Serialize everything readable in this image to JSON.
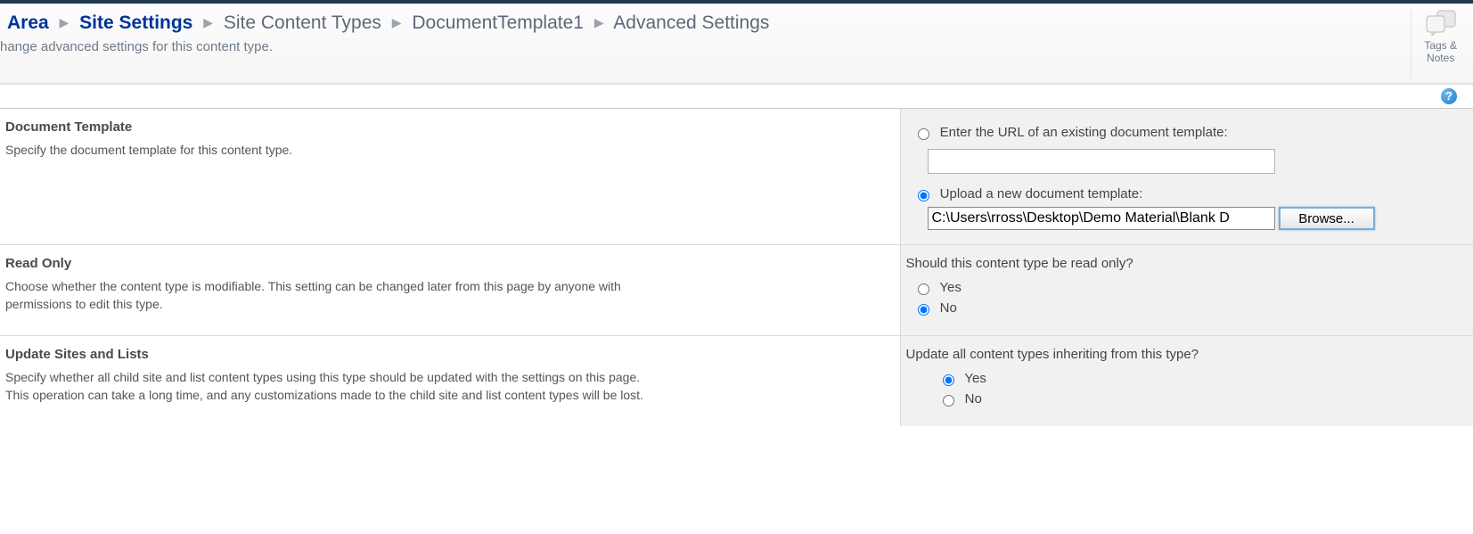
{
  "header": {
    "breadcrumb": {
      "area": "Area",
      "site_settings": "Site Settings",
      "site_content_types": "Site Content Types",
      "doc_template": "DocumentTemplate1",
      "advanced": "Advanced Settings"
    },
    "subtitle": "hange advanced settings for this content type.",
    "tags_notes": "Tags &\nNotes"
  },
  "sections": {
    "doc_template": {
      "title": "Document Template",
      "desc": "Specify the document template for this content type.",
      "opt_url_label": "Enter the URL of an existing document template:",
      "opt_upload_label": "Upload a new document template:",
      "url_value": "",
      "file_value": "C:\\Users\\rross\\Desktop\\Demo Material\\Blank D",
      "browse_label": "Browse...",
      "selected": "upload"
    },
    "read_only": {
      "title": "Read Only",
      "desc": "Choose whether the content type is modifiable. This setting can be changed later from this page by anyone with permissions to edit this type.",
      "question": "Should this content type be read only?",
      "yes": "Yes",
      "no": "No",
      "selected": "no"
    },
    "update": {
      "title": "Update Sites and Lists",
      "desc": "Specify whether all child site and list content types using this type should be updated with the settings on this page. This operation can take a long time, and any customizations made to the child site and list content types will be lost.",
      "question": "Update all content types inheriting from this type?",
      "yes": "Yes",
      "no": "No",
      "selected": "yes"
    }
  }
}
